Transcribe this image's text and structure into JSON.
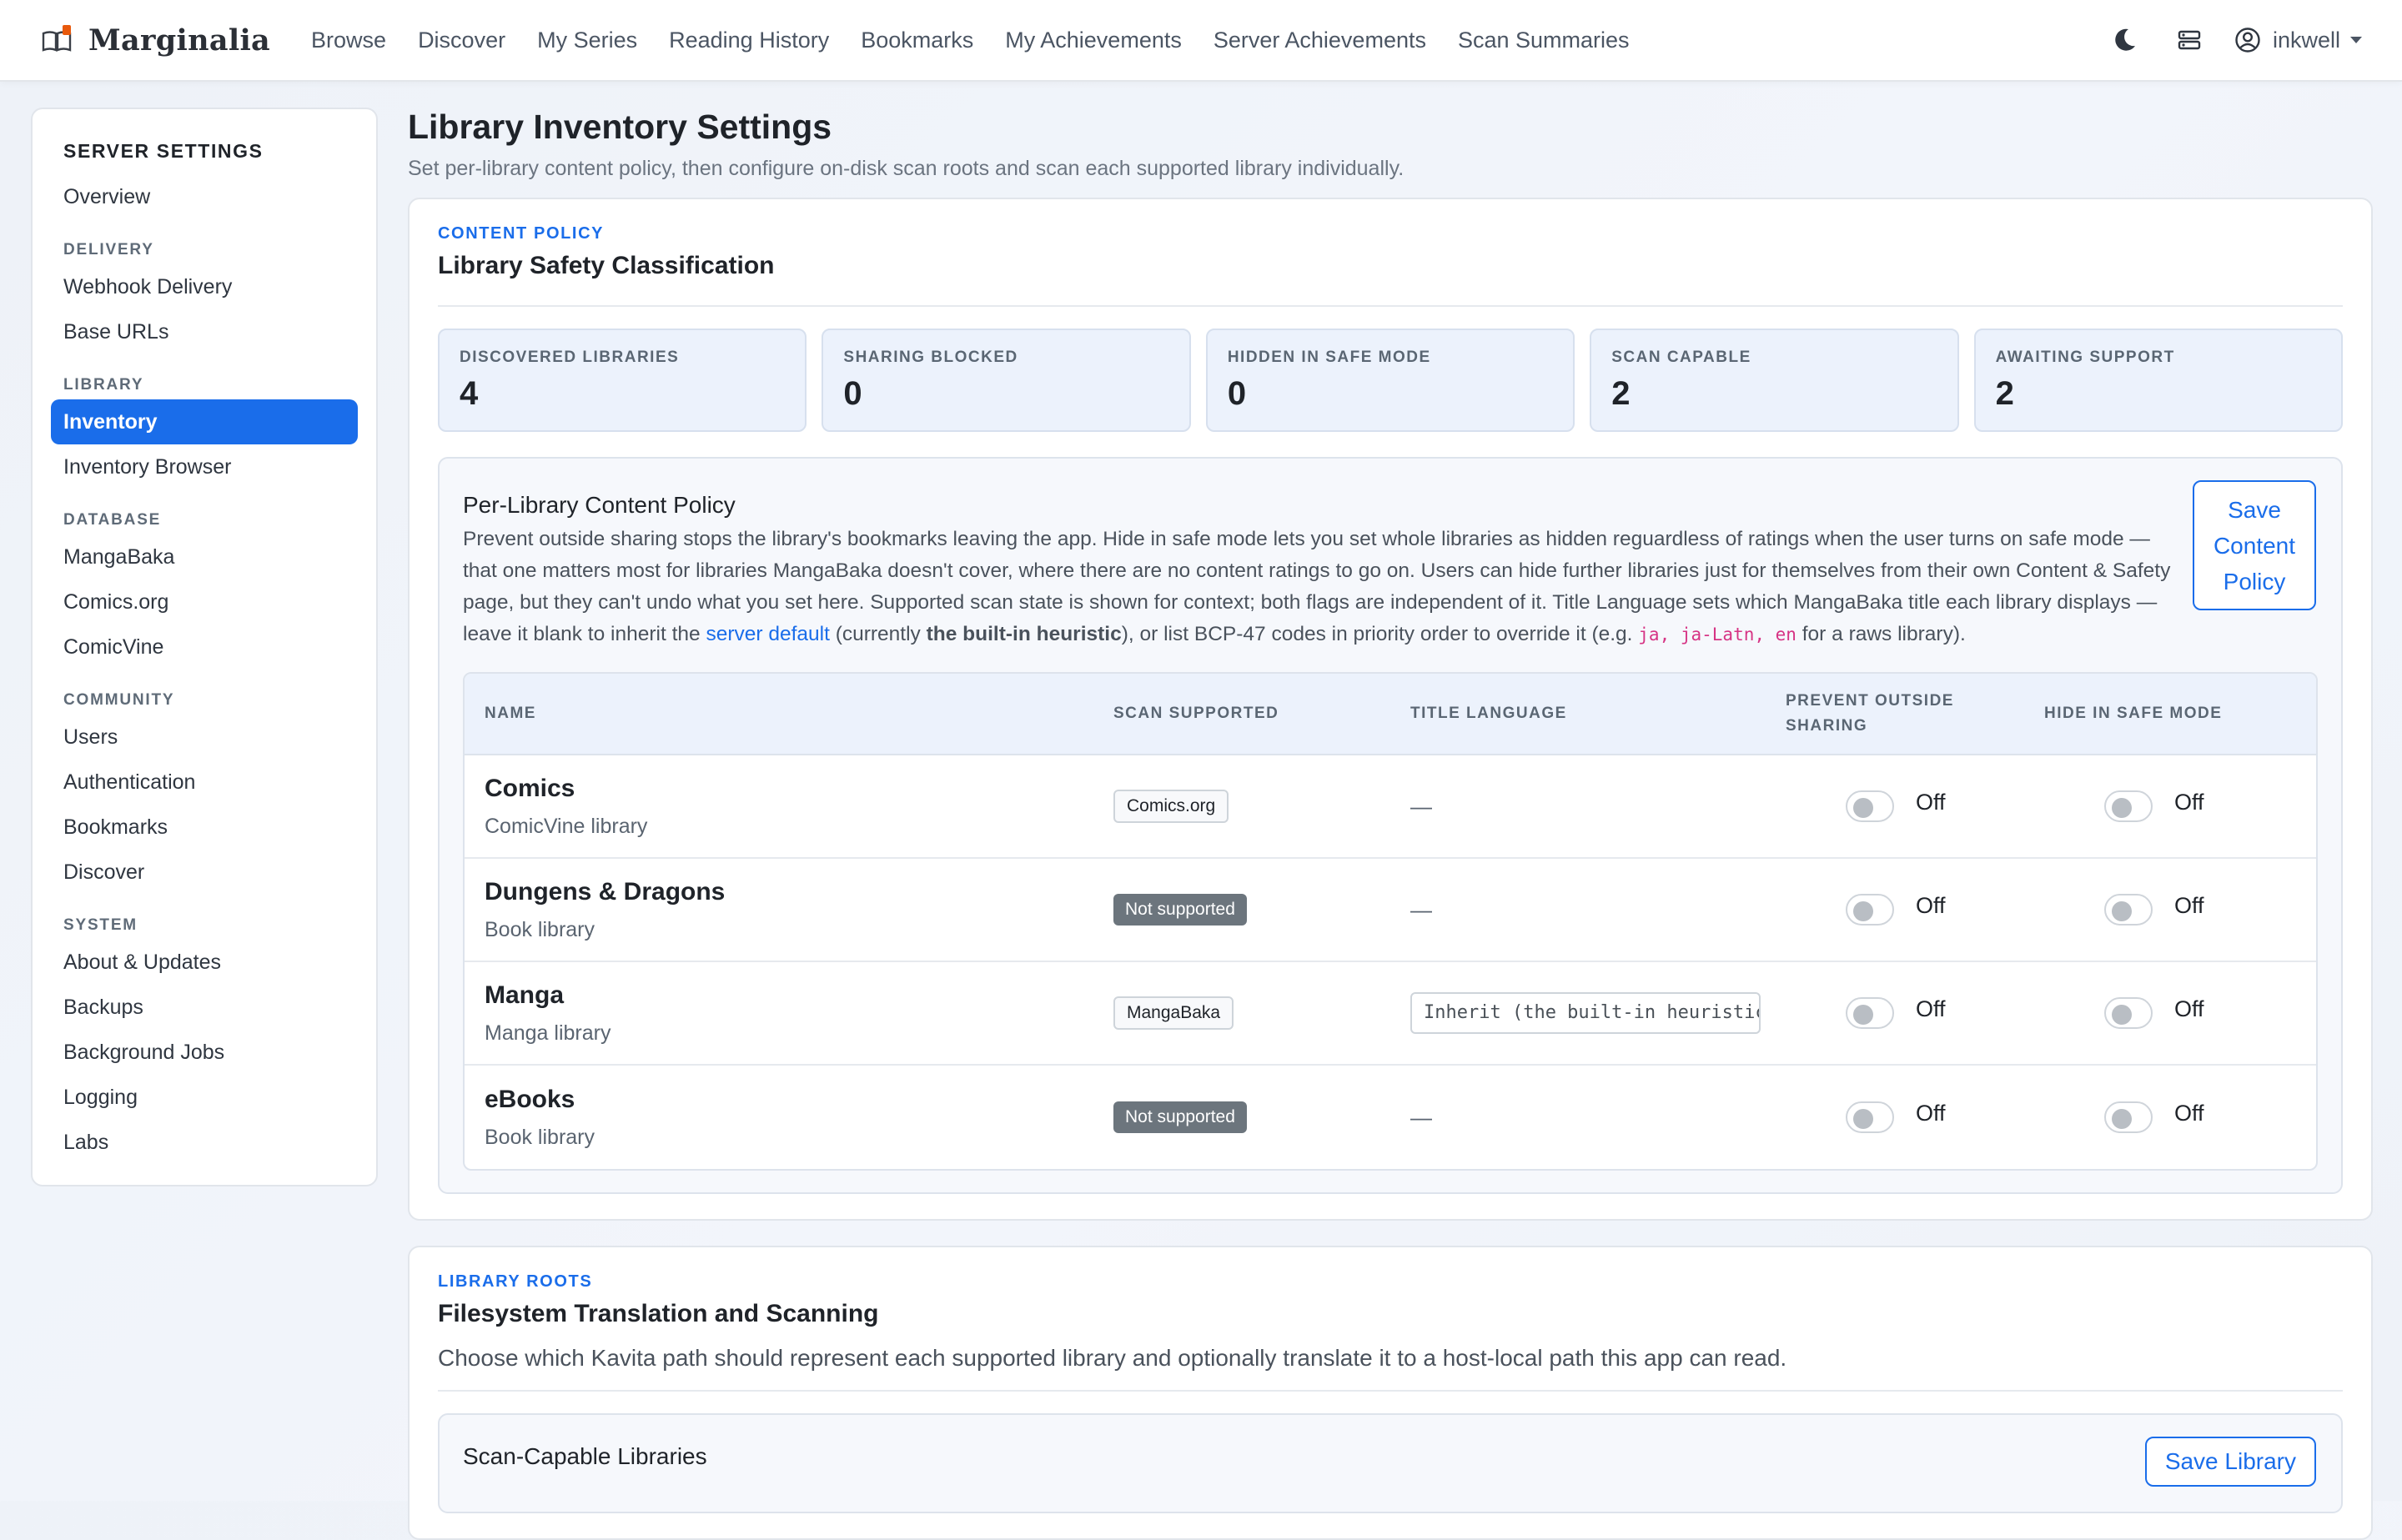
{
  "brand": {
    "name": "Marginalia"
  },
  "nav": {
    "links": [
      "Browse",
      "Discover",
      "My Series",
      "Reading History",
      "Bookmarks",
      "My Achievements",
      "Server Achievements",
      "Scan Summaries"
    ],
    "user": "inkwell"
  },
  "sidebar": {
    "title": "SERVER SETTINGS",
    "overview": "Overview",
    "groups": {
      "delivery": "DELIVERY",
      "library": "LIBRARY",
      "database": "DATABASE",
      "community": "COMMUNITY",
      "system": "SYSTEM"
    },
    "delivery_items": [
      "Webhook Delivery",
      "Base URLs"
    ],
    "library_items": [
      "Inventory",
      "Inventory Browser"
    ],
    "database_items": [
      "MangaBaka",
      "Comics.org",
      "ComicVine"
    ],
    "community_items": [
      "Users",
      "Authentication",
      "Bookmarks",
      "Discover"
    ],
    "system_items": [
      "About & Updates",
      "Backups",
      "Background Jobs",
      "Logging",
      "Labs"
    ]
  },
  "page": {
    "title": "Library Inventory Settings",
    "subtitle": "Set per-library content policy, then configure on-disk scan roots and scan each supported library individually."
  },
  "policy_card": {
    "eyebrow": "CONTENT POLICY",
    "title": "Library Safety Classification",
    "stats": [
      {
        "label": "DISCOVERED LIBRARIES",
        "value": "4"
      },
      {
        "label": "SHARING BLOCKED",
        "value": "0"
      },
      {
        "label": "HIDDEN IN SAFE MODE",
        "value": "0"
      },
      {
        "label": "SCAN CAPABLE",
        "value": "2"
      },
      {
        "label": "AWAITING SUPPORT",
        "value": "2"
      }
    ],
    "box_title": "Per-Library Content Policy",
    "desc_part1": "Prevent outside sharing stops the library's bookmarks leaving the app. Hide in safe mode lets you set whole libraries as hidden reguardless of ratings when the user turns on safe mode — that one matters most for libraries MangaBaka doesn't cover, where there are no content ratings to go on. Users can hide further libraries just for themselves from their own Content & Safety page, but they can't undo what you set here. Supported scan state is shown for context; both flags are independent of it. Title Language sets which MangaBaka title each library displays — leave it blank to inherit the ",
    "desc_link": "server default",
    "desc_part2": " (currently ",
    "desc_bold": "the built-in heuristic",
    "desc_part3": "), or list BCP-47 codes in priority order to override it (e.g. ",
    "desc_code": "ja, ja-Latn, en",
    "desc_part4": " for a raws library).",
    "save_label": "Save Content Policy",
    "columns": {
      "name": "NAME",
      "scan": "SCAN SUPPORTED",
      "lang": "TITLE LANGUAGE",
      "share": "PREVENT OUTSIDE SHARING",
      "hide": "HIDE IN SAFE MODE"
    },
    "rows": [
      {
        "name": "Comics",
        "type": "ComicVine library",
        "scan": "Comics.org",
        "lang": "—",
        "share": "Off",
        "hide": "Off"
      },
      {
        "name": "Dungens & Dragons",
        "type": "Book library",
        "scan": "Not supported",
        "lang": "—",
        "share": "Off",
        "hide": "Off"
      },
      {
        "name": "Manga",
        "type": "Manga library",
        "scan": "MangaBaka",
        "lang_placeholder": "Inherit (the built-in heuristic)",
        "share": "Off",
        "hide": "Off"
      },
      {
        "name": "eBooks",
        "type": "Book library",
        "scan": "Not supported",
        "lang": "—",
        "share": "Off",
        "hide": "Off"
      }
    ]
  },
  "roots_card": {
    "eyebrow": "LIBRARY ROOTS",
    "title": "Filesystem Translation and Scanning",
    "desc": "Choose which Kavita path should represent each supported library and optionally translate it to a host-local path this app can read.",
    "box_title": "Scan-Capable Libraries",
    "save_label": "Save Library"
  }
}
